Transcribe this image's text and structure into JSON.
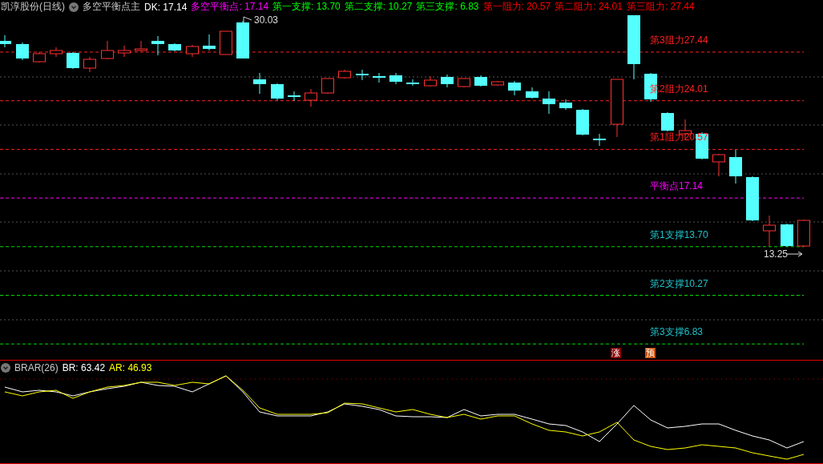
{
  "header": {
    "stock": "凯淳股份(日线)",
    "indicator": "多空平衡点主",
    "values": [
      {
        "text": "DK: 17.14",
        "color": "#ffffff"
      },
      {
        "text": "多空平衡点: 17.14",
        "color": "#ff00ff"
      },
      {
        "text": "第一支撑: 13.70",
        "color": "#00ff00"
      },
      {
        "text": "第二支撑: 10.27",
        "color": "#00ff00"
      },
      {
        "text": "第三支撑: 6.83",
        "color": "#00ff00"
      },
      {
        "text": "第一阻力: 20.57",
        "color": "#ff0000"
      },
      {
        "text": "第二阻力: 24.01",
        "color": "#ff0000"
      },
      {
        "text": "第三阻力: 27.44",
        "color": "#ff0000"
      }
    ]
  },
  "levels": [
    {
      "label": "第3阻力27.44",
      "kind": "resistance"
    },
    {
      "label": "第2阻力24.01",
      "kind": "resistance"
    },
    {
      "label": "第1阻力20.57",
      "kind": "resistance"
    },
    {
      "label": "平衡点17.14",
      "kind": "balance"
    },
    {
      "label": "第1支撑13.70",
      "kind": "support"
    },
    {
      "label": "第2支撑10.27",
      "kind": "support"
    },
    {
      "label": "第3支撑6.83",
      "kind": "support"
    }
  ],
  "high_label": "30.03",
  "low_label": "13.25",
  "signals": [
    {
      "text": "涨",
      "color": "#8b0000"
    },
    {
      "text": "预",
      "color": "#c8500a"
    }
  ],
  "sub_header": {
    "name": "BRAR(26)",
    "values": [
      {
        "text": "BR: 63.42",
        "color": "#ffffff"
      },
      {
        "text": "AR: 46.93",
        "color": "#ffff00"
      }
    ]
  }
}
